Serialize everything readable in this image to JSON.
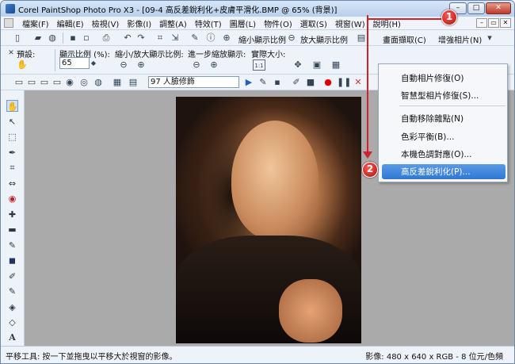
{
  "window": {
    "title": "Corel PaintShop Photo Pro X3 - [09-4 高反差銳利化+皮膚平滑化.BMP @ 65% (背景)]",
    "buttons": {
      "minimize": "–",
      "maximize": "□",
      "close": "✕"
    }
  },
  "menubar": {
    "items": [
      "檔案(F)",
      "編輯(E)",
      "檢視(V)",
      "影像(I)",
      "調整(A)",
      "特效(T)",
      "圖層(L)",
      "物件(O)",
      "選取(S)",
      "視窗(W)",
      "說明(H)"
    ],
    "mdi_buttons": [
      "–",
      "▭",
      "✕"
    ]
  },
  "toolbar1": {
    "zoom_in_label": "縮小顯示比例",
    "zoom_out_label": "放大顯示比例",
    "capture_label": "畫面擷取(C)",
    "enhance_label": "增強相片(N)"
  },
  "toolbar2": {
    "preset_label": "預設:",
    "zoom_ratio_label": "顯示比例 (%):",
    "zoom_value": "65",
    "zoom_inout_label": "縮小/放大顯示比例:",
    "step_label": "進一步縮放顯示:",
    "actual_label": "實際大小:",
    "actual_icon_text": "1:1"
  },
  "toolbar3": {
    "script_value": "97 人臉修飾"
  },
  "status": {
    "left": "平移工具: 按一下並拖曳以平移大於視窗的影像。",
    "right": "影像: 480 x 640 x RGB - 8 位元/色頻"
  },
  "popup": {
    "items": [
      "自動相片修復(O)",
      "智慧型相片修復(S)...",
      "自動移除雜點(N)",
      "色彩平衡(B)...",
      "本機色調對應(O)...",
      "高反差銳利化(P)..."
    ],
    "highlighted_index": 5
  },
  "callouts": {
    "one": "1",
    "two": "2"
  },
  "colors": {
    "accent": "#2f77d2",
    "callout": "#d3202a"
  }
}
